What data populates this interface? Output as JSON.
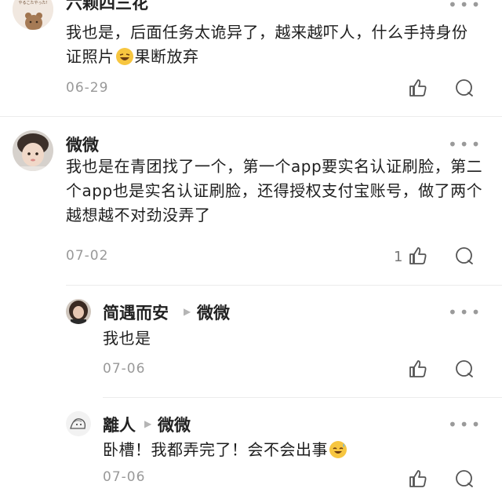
{
  "comments": [
    {
      "user": "六颗四三花",
      "avatar_text": "やるこたやった!",
      "text": "我也是，后面任务太诡异了，越来越吓人，什么手持身份证照片",
      "text_after_emoji": "果断放弃",
      "date": "06-29",
      "likes": ""
    },
    {
      "user": "微微",
      "text": "我也是在青团找了一个，第一个app要实名认证刷脸，第二个app也是实名认证刷脸，还得授权支付宝账号，做了两个越想越不对劲没弄了",
      "date": "07-02",
      "likes": "1"
    }
  ],
  "replies": [
    {
      "user": "简遇而安",
      "reply_to": "微微",
      "text": "我也是",
      "date": "07-06"
    },
    {
      "user": "離人",
      "reply_to": "微微",
      "text": "卧槽！我都弄完了！会不会出事",
      "date": "07-06"
    }
  ],
  "more_label": "•••",
  "colors": {
    "text": "#1e1e1e",
    "muted": "#999999",
    "divider": "#ececec"
  }
}
